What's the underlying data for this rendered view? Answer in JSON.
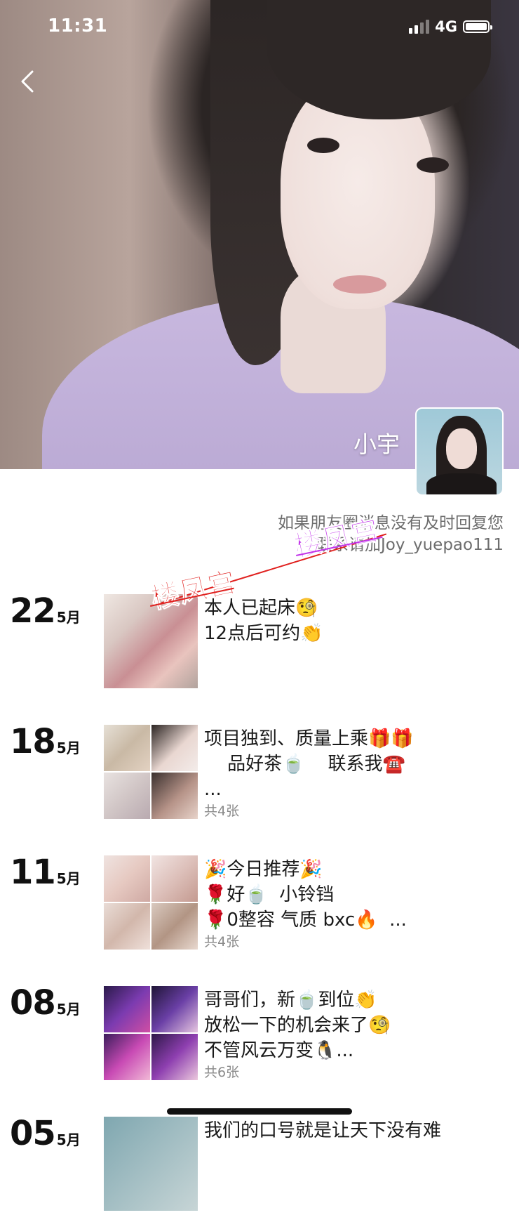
{
  "status_bar": {
    "time": "11:31",
    "network": "4G"
  },
  "profile": {
    "name": "小宇",
    "notice_line1": "如果朋友圈消息没有及时回复您",
    "notice_line2": "联系请加Joy_yuepao111"
  },
  "watermarks": [
    "楼凤宫",
    "楼凤宫"
  ],
  "posts": [
    {
      "day": "22",
      "month": "5月",
      "text": "本人已起床🧐\n12点后可约👏",
      "count": ""
    },
    {
      "day": "18",
      "month": "5月",
      "text": "项目独到、质量上乘🎁🎁\n    品好茶🍵    联系我☎️\n...",
      "count": "共4张"
    },
    {
      "day": "11",
      "month": "5月",
      "text": "🎉今日推荐🎉\n🌹好🍵  小铃铛\n🌹0整容 气质 bxc🔥  ...",
      "count": "共4张"
    },
    {
      "day": "08",
      "month": "5月",
      "text": "哥哥们，新🍵到位👏\n放松一下的机会来了🧐\n不管风云万变🐧...",
      "count": "共6张"
    },
    {
      "day": "05",
      "month": "5月",
      "text": "我们的口号就是让天下没有难",
      "count": ""
    }
  ],
  "colors": {
    "watermark_red": "#e0201e",
    "watermark_purple": "#c233ea",
    "notice_gray": "#6d6d6d"
  }
}
